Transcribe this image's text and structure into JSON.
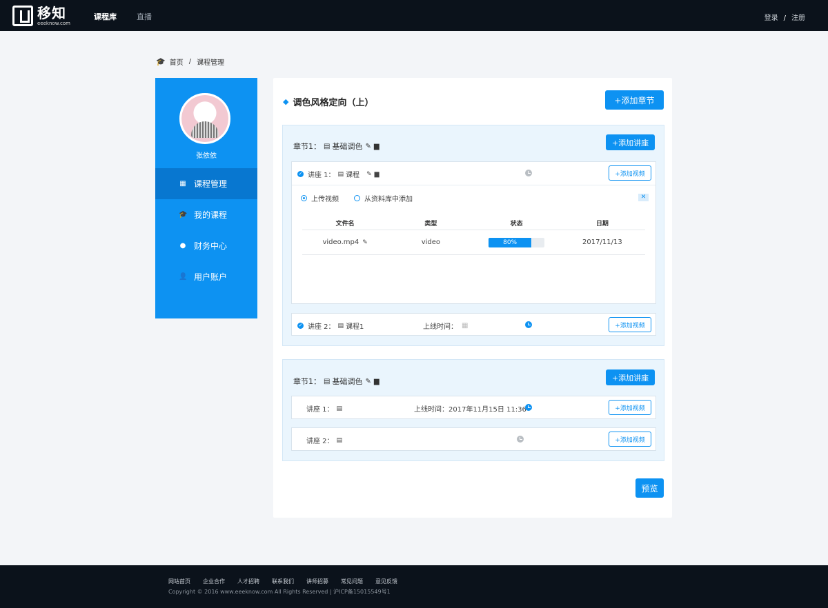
{
  "header": {
    "logo_cn": "移知",
    "logo_en": "eeeknow.com",
    "nav": [
      "课程库",
      "直播"
    ],
    "login": "登录",
    "separator": "/",
    "register": "注册"
  },
  "breadcrumb": {
    "home": "首页",
    "separator": "/",
    "current": "课程管理"
  },
  "sidebar": {
    "user_name": "张依依",
    "items": [
      {
        "label": "课程管理",
        "icon": "calendar-icon",
        "active": true
      },
      {
        "label": "我的课程",
        "icon": "graduation-cap-icon",
        "active": false
      },
      {
        "label": "财务中心",
        "icon": "money-bag-icon",
        "active": false
      },
      {
        "label": "用户账户",
        "icon": "user-icon",
        "active": false
      }
    ]
  },
  "main": {
    "course_title": "调色风格定向（上）",
    "add_chapter": "+添加章节",
    "preview": "预览",
    "chapters": [
      {
        "title": "章节1：",
        "name": "基础调色",
        "add_lecture": "+添加讲座",
        "lectures": [
          {
            "label": "讲座 1：",
            "name": "课程",
            "add_video": "+添加视频",
            "upload": {
              "options": [
                "上传视频",
                "从资料库中添加"
              ],
              "close": "✕",
              "columns": [
                "文件名",
                "类型",
                "状态",
                "日期"
              ],
              "rows": [
                {
                  "file": "video.mp4",
                  "type": "video",
                  "progress": "80%",
                  "progress_value": 80,
                  "date": "2017/11/13"
                }
              ]
            }
          },
          {
            "label": "讲座 2：",
            "name": "课程1",
            "online_label": "上线时间：",
            "add_video": "+添加视频"
          }
        ]
      },
      {
        "title": "章节1：",
        "name": "基础调色",
        "add_lecture": "+添加讲座",
        "lectures": [
          {
            "label": "讲座 1：",
            "online_label": "上线时间：2017年11月15日 11:36",
            "add_video": "+添加视频"
          },
          {
            "label": "讲座 2：",
            "add_video": "+添加视频"
          }
        ]
      }
    ]
  },
  "footer": {
    "links": [
      "网站首页",
      "企业合作",
      "人才招聘",
      "联系我们",
      "讲师招募",
      "常见问题",
      "意见反馈"
    ],
    "copyright": "Copyright © 2016 www.eeeknow.com All Rights Reserved | 沪ICP备15015549号1"
  },
  "colors": {
    "accent": "#0d92f2",
    "topbar": "#0b121b",
    "active_menu": "#0877d0"
  }
}
